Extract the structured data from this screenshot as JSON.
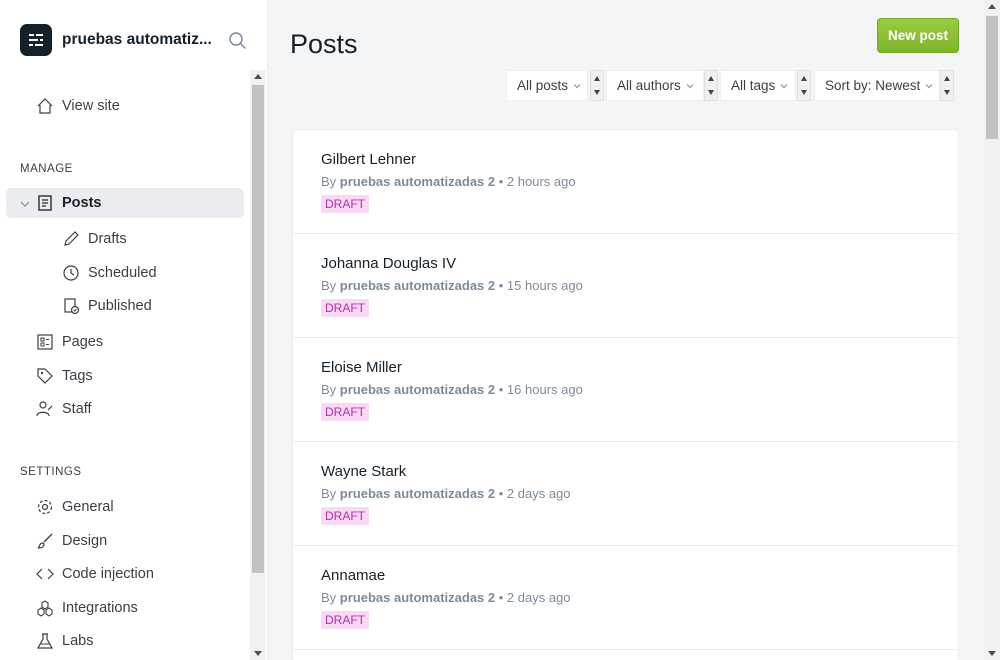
{
  "sidebar": {
    "site_name": "pruebas automatiz...",
    "view_site": "View site",
    "manage_label": "MANAGE",
    "posts": "Posts",
    "drafts": "Drafts",
    "scheduled": "Scheduled",
    "published": "Published",
    "pages": "Pages",
    "tags": "Tags",
    "staff": "Staff",
    "settings_label": "SETTINGS",
    "general": "General",
    "design": "Design",
    "code_injection": "Code injection",
    "integrations": "Integrations",
    "labs": "Labs"
  },
  "header": {
    "title": "Posts",
    "new_post": "New post"
  },
  "filters": {
    "type": "All posts",
    "authors": "All authors",
    "tags": "All tags",
    "sort": "Sort by: Newest"
  },
  "posts": [
    {
      "title": "Gilbert Lehner",
      "by": "By",
      "author": "pruebas automatizadas 2",
      "time": "2 hours ago",
      "status": "DRAFT"
    },
    {
      "title": "Johanna Douglas IV",
      "by": "By",
      "author": "pruebas automatizadas 2",
      "time": "15 hours ago",
      "status": "DRAFT"
    },
    {
      "title": "Eloise Miller",
      "by": "By",
      "author": "pruebas automatizadas 2",
      "time": "16 hours ago",
      "status": "DRAFT"
    },
    {
      "title": "Wayne Stark",
      "by": "By",
      "author": "pruebas automatizadas 2",
      "time": "2 days ago",
      "status": "DRAFT"
    },
    {
      "title": "Annamae",
      "by": "By",
      "author": "pruebas automatizadas 2",
      "time": "2 days ago",
      "status": "DRAFT"
    }
  ],
  "colors": {
    "accent_green": "#9acb42",
    "draft_bg": "#f8d8f4",
    "draft_text": "#b72fa6"
  },
  "icons": {
    "search": "search-icon",
    "view_site": "house-icon",
    "posts": "document-icon",
    "drafts": "pencil-icon",
    "scheduled": "clock-icon",
    "published": "published-icon",
    "pages": "pages-icon",
    "tags": "tag-icon",
    "staff": "user-icon",
    "general": "gear-icon",
    "design": "brush-icon",
    "code_injection": "code-icon",
    "integrations": "integrations-icon",
    "labs": "flask-icon"
  }
}
